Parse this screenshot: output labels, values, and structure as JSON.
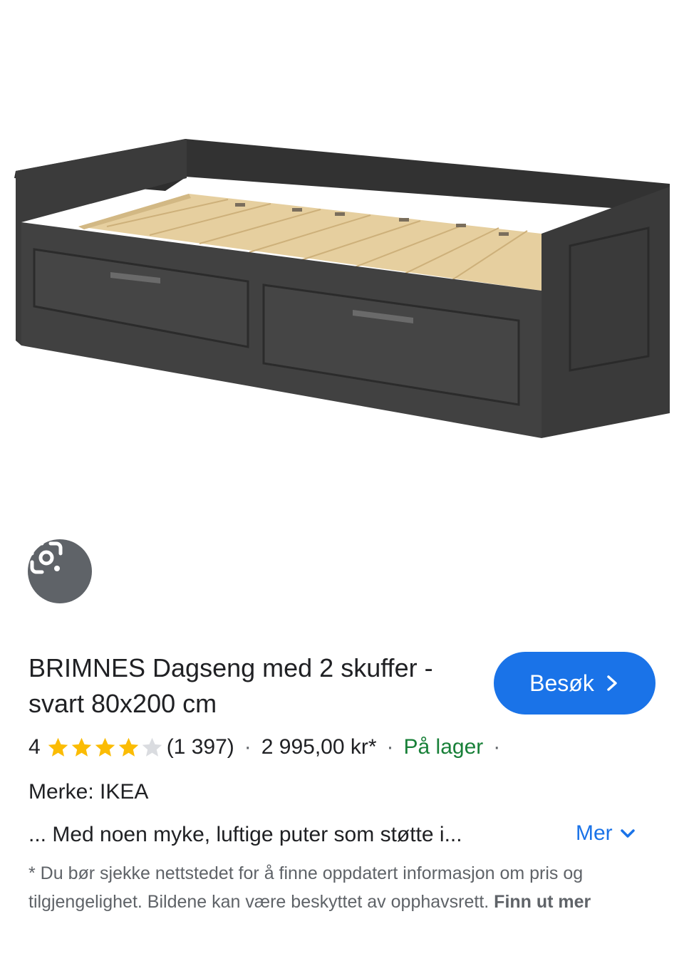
{
  "product": {
    "title": "BRIMNES Dagseng med 2 skuffer - svart 80x200 cm",
    "visit_label": "Besøk",
    "rating_value": "4",
    "rating_stars": 4,
    "rating_max": 5,
    "review_count": "(1 397)",
    "price": "2 995,00 kr*",
    "stock": "På lager",
    "sep": "·",
    "brand": "Merke: IKEA",
    "snippet": "... Med noen myke, luftige puter som støtte i...",
    "more_label": "Mer",
    "disclaimer": "* Du bør sjekke nettstedet for å finne oppdatert informasjon om pris og tilgjengelighet. Bildene kan være beskyttet av opphavsrett. ",
    "learn_more": "Finn ut mer"
  },
  "colors": {
    "accent": "#1a73e8",
    "stock_green": "#188038",
    "star_filled": "#fbbc04",
    "star_empty": "#dadce0",
    "text": "#202124",
    "secondary": "#5f6368"
  },
  "icons": {
    "lens": "google-lens-icon",
    "visit_chevron": "chevron-right-icon",
    "more_chevron": "chevron-down-icon",
    "star": "star-icon"
  }
}
